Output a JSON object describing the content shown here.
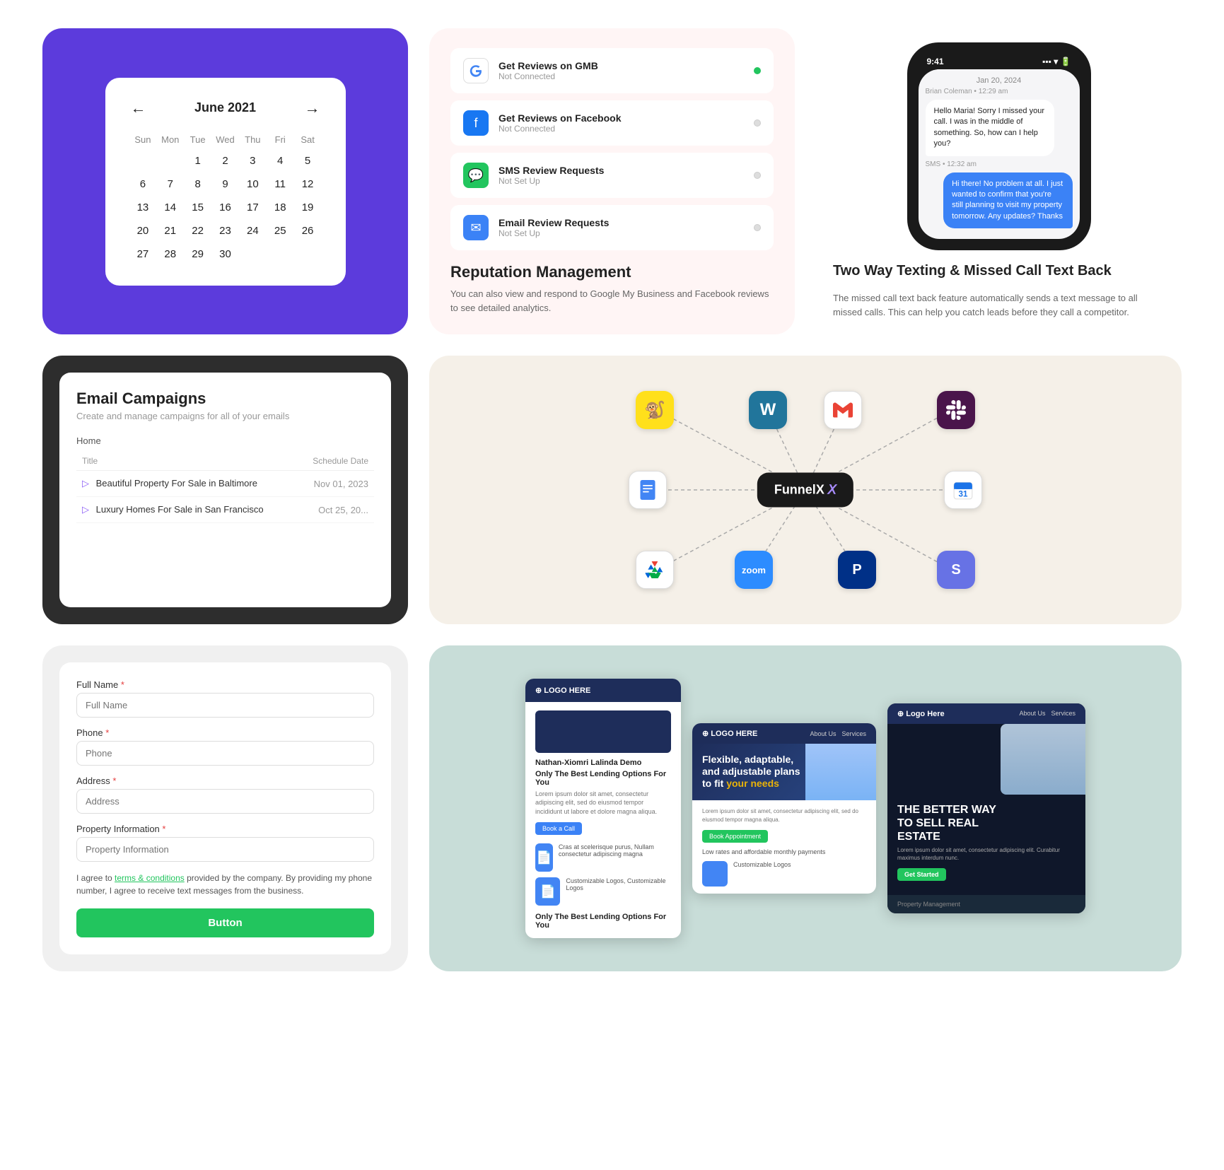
{
  "calendar": {
    "month": "June 2021",
    "days_of_week": [
      "Sun",
      "Mon",
      "Tue",
      "Wed",
      "Thu",
      "Fri",
      "Sat"
    ],
    "weeks": [
      [
        "",
        "",
        "1",
        "2",
        "3",
        "4",
        "5"
      ],
      [
        "6",
        "7",
        "8",
        "9",
        "10",
        "11",
        "12"
      ],
      [
        "13",
        "14",
        "15",
        "16",
        "17",
        "18",
        "19"
      ],
      [
        "20",
        "21",
        "22",
        "23",
        "24",
        "25",
        "26"
      ],
      [
        "27",
        "28",
        "29",
        "30",
        "",
        "",
        ""
      ]
    ]
  },
  "reputation": {
    "title": "Reputation Management",
    "description": "You can also view and respond to Google My Business and Facebook reviews to see detailed analytics.",
    "items": [
      {
        "icon": "G",
        "label": "Get Reviews on GMB",
        "status": "Not Connected",
        "connected": true
      },
      {
        "icon": "f",
        "label": "Get Reviews on Facebook",
        "status": "Not Connected",
        "connected": false
      },
      {
        "icon": "💬",
        "label": "SMS Review Requests",
        "status": "Not Set Up",
        "connected": false
      },
      {
        "icon": "✉",
        "label": "Email Review Requests",
        "status": "Not Set Up",
        "connected": false
      }
    ]
  },
  "texting": {
    "heading": "Two Way Texting & Missed Call Text Back",
    "description": "The missed call text back feature automatically sends a text message to all missed calls. This can help you catch leads before they call a competitor.",
    "time": "9:41",
    "chat_date": "Jan 20, 2024",
    "sender": "Brian Coleman • 12:29 am",
    "msg1": "Hello Maria! Sorry I missed your call. I was in the middle of something. So, how can I help you?",
    "sms_label": "SMS • 12:32 am",
    "msg2": "Hi there! No problem at all. I just wanted to confirm that you're still planning to visit my property tomorrow. Any updates? Thanks"
  },
  "email_campaigns": {
    "title": "Email Campaigns",
    "subtitle": "Create and manage campaigns for all of your emails",
    "section": "Home",
    "col_title": "Title",
    "col_date": "Schedule Date",
    "rows": [
      {
        "icon": "▷",
        "title": "Beautiful Property For Sale in Baltimore",
        "date": "Nov 01, 2023"
      },
      {
        "icon": "▷",
        "title": "Luxury Homes For Sale in San Francisco",
        "date": "Oct 25, 20..."
      }
    ]
  },
  "integrations": {
    "center_label": "FunnelX",
    "icons": [
      {
        "id": "mailchimp",
        "label": "Mailchimp",
        "symbol": "🐒"
      },
      {
        "id": "wordpress",
        "label": "WordPress",
        "symbol": "W"
      },
      {
        "id": "gmail",
        "label": "Gmail",
        "symbol": "M"
      },
      {
        "id": "slack",
        "label": "Slack",
        "symbol": "#"
      },
      {
        "id": "gdocs",
        "label": "Google Docs",
        "symbol": "📄"
      },
      {
        "id": "gcal",
        "label": "Google Calendar",
        "symbol": "31"
      },
      {
        "id": "gdrive",
        "label": "Google Drive",
        "symbol": "▲"
      },
      {
        "id": "zoom",
        "label": "Zoom",
        "symbol": "zoom"
      },
      {
        "id": "paypal",
        "label": "PayPal",
        "symbol": "P"
      },
      {
        "id": "stripe",
        "label": "Stripe",
        "symbol": "S"
      }
    ]
  },
  "lead_form": {
    "fields": [
      {
        "label": "Full Name",
        "placeholder": "Full Name",
        "required": true
      },
      {
        "label": "Phone",
        "placeholder": "Phone",
        "required": true
      },
      {
        "label": "Address",
        "placeholder": "Address",
        "required": true
      },
      {
        "label": "Property Information",
        "placeholder": "Property Information",
        "required": true
      }
    ],
    "agreement": "I agree to terms & conditions provided by the company. By providing my phone number, I agree to receive text messages from the business.",
    "button_label": "Button"
  },
  "landing_pages": {
    "pages": [
      {
        "logo": "LOGO HERE",
        "headline": "Only The Best Lending Options For You",
        "btn": "Book a Call"
      },
      {
        "logo": "LOGO HERE",
        "headline": "Flexible, adaptable, and adjustable plans to fit your needs",
        "highlight": "your needs",
        "btn": "Book Appointment"
      },
      {
        "logo": "Logo Here",
        "headline": "THE BETTER WAY TO SELL REAL ESTATE",
        "badge": "Get Started",
        "footer": "Property Management"
      }
    ]
  }
}
